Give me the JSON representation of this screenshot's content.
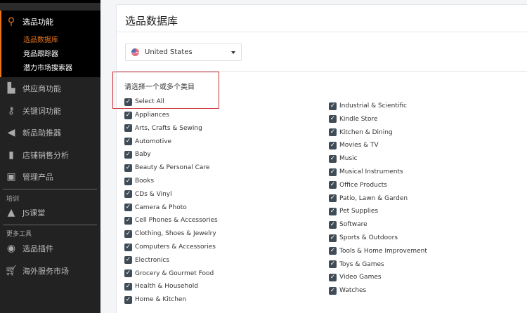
{
  "sidebar": {
    "active_group": "选品功能",
    "sub_items": [
      "选品数据库",
      "竞品跟踪器",
      "潜力市场搜索器"
    ],
    "items": [
      "供应商功能",
      "关键词功能",
      "新品助推器",
      "店铺销售分析",
      "管理产品"
    ],
    "section_training": "培训",
    "training_item": "JS课堂",
    "section_more": "更多工具",
    "more_items": [
      "选品插件",
      "海外服务市场"
    ]
  },
  "main": {
    "title": "选品数据库",
    "marketplace": "United States",
    "prompt": "请选择一个或多个类目",
    "select_all": "Select All",
    "left_categories": [
      "Appliances",
      "Arts, Crafts & Sewing",
      "Automotive",
      "Baby",
      "Beauty & Personal Care",
      "Books",
      "CDs & Vinyl",
      "Camera & Photo",
      "Cell Phones & Accessories",
      "Clothing, Shoes & Jewelry",
      "Computers & Accessories",
      "Electronics",
      "Grocery & Gourmet Food",
      "Health & Household",
      "Home & Kitchen"
    ],
    "right_categories": [
      "Industrial & Scientific",
      "Kindle Store",
      "Kitchen & Dining",
      "Movies & TV",
      "Music",
      "Musical Instruments",
      "Office Products",
      "Patio, Lawn & Garden",
      "Pet Supplies",
      "Software",
      "Sports & Outdoors",
      "Tools & Home Improvement",
      "Toys & Games",
      "Video Games",
      "Watches"
    ]
  },
  "colors": {
    "accent": "#e8751a",
    "checkbox": "#3f4c57",
    "highlight": "#c8323a"
  }
}
